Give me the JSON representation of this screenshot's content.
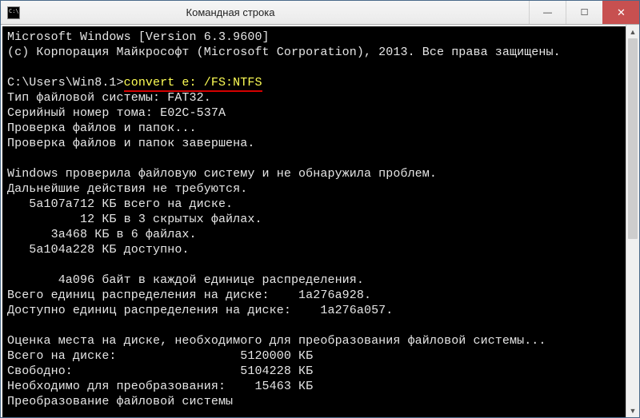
{
  "window": {
    "title": "Командная строка",
    "icon_name": "cmd-icon"
  },
  "controls": {
    "minimize": "—",
    "maximize": "☐",
    "close": "✕"
  },
  "terminal": {
    "header1": "Microsoft Windows [Version 6.3.9600]",
    "header2": "(с) Корпорация Майкрософт (Microsoft Corporation), 2013. Все права защищены.",
    "blank": "",
    "prompt": "C:\\Users\\Win8.1>",
    "command": "convert e: /FS:NTFS",
    "fs_type": "Тип файловой системы: FAT32.",
    "vol_serial": "Серийный номер тома: E02C-537A",
    "checking": "Проверка файлов и папок...",
    "checking_done": "Проверка файлов и папок завершена.",
    "noproblems": "Windows проверила файловую систему и не обнаружила проблем.",
    "noaction": "Дальнейшие действия не требуются.",
    "total_kb": "   5а107а712 КБ всего на диске.",
    "hidden_kb": "          12 КБ в 3 скрытых файлах.",
    "infiles_kb": "      3а468 КБ в 6 файлах.",
    "avail_kb": "   5а104а228 КБ доступно.",
    "alloc_unit": "       4а096 байт в каждой единице распределения.",
    "alloc_total": "Всего единиц распределения на диске:    1а276а928.",
    "alloc_avail": "Доступно единиц распределения на диске:    1а276а057.",
    "estimate": "Оценка места на диске, необходимого для преобразования файловой системы...",
    "disk_total": "Всего на диске:                 5120000 КБ",
    "disk_free": "Свободно:                       5104228 КБ",
    "disk_needed": "Необходимо для преобразования:    15463 КБ",
    "converting": "Преобразование файловой системы"
  },
  "scrollbar": {
    "up": "▲",
    "down": "▼"
  }
}
